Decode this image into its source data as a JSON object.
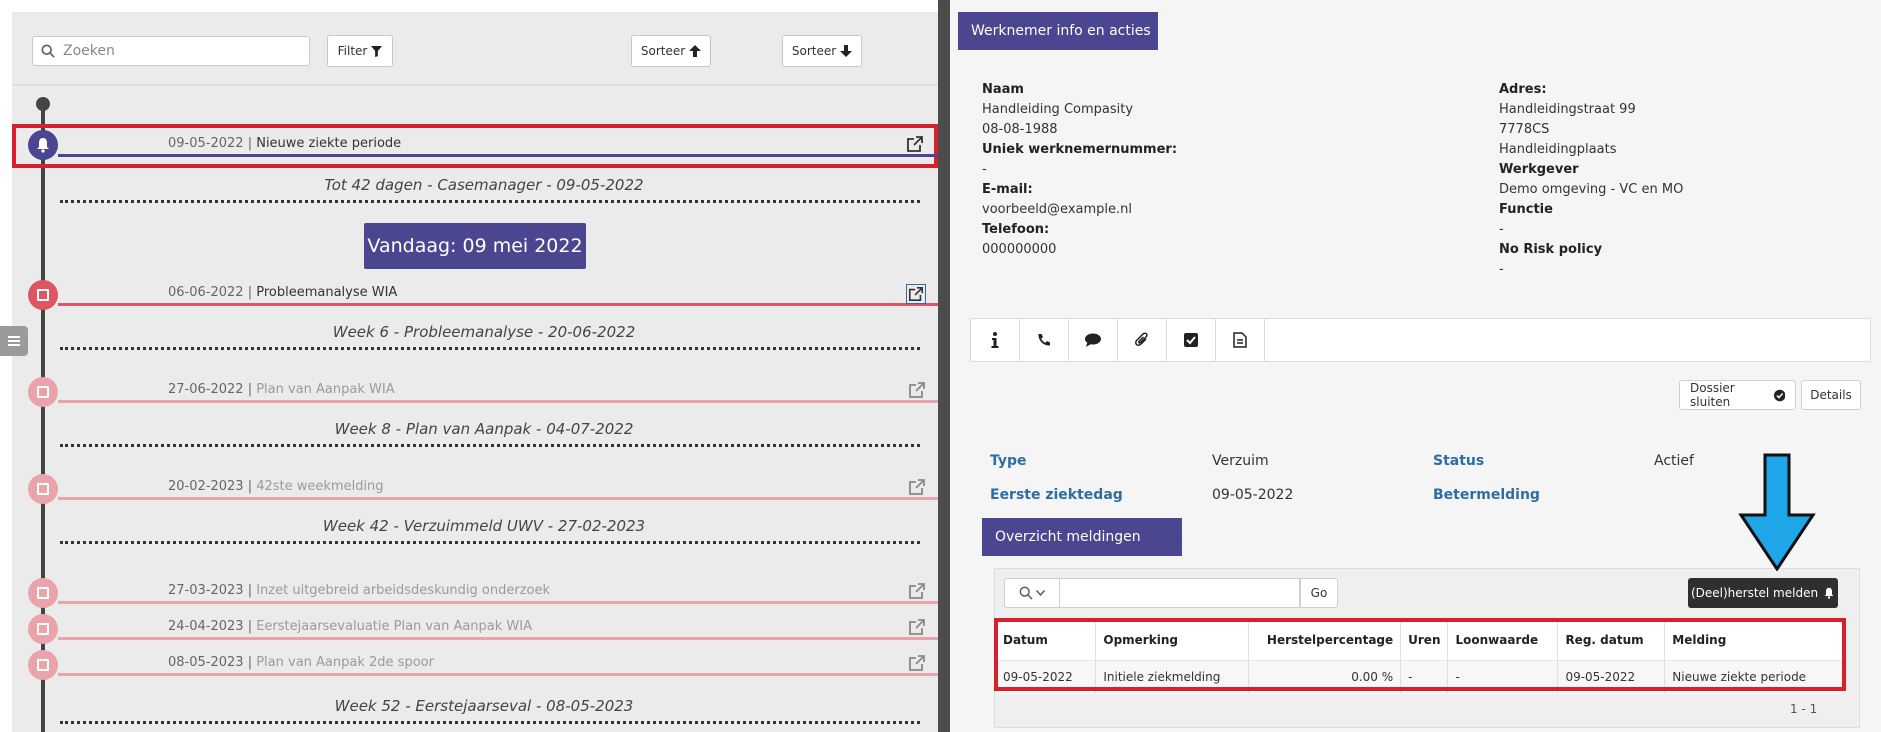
{
  "toolbar": {
    "search_placeholder": "Zoeken",
    "filter_label": "Filter",
    "sort_asc_label": "Sorteer",
    "sort_desc_label": "Sorteer"
  },
  "timeline": {
    "events": [
      {
        "date": "09-05-2022",
        "desc": "Nieuwe ziekte periode"
      },
      {
        "date": "06-06-2022",
        "desc": "Probleemanalyse WIA"
      },
      {
        "date": "27-06-2022",
        "desc": "Plan van Aanpak WIA"
      },
      {
        "date": "20-02-2023",
        "desc": "42ste weekmelding"
      },
      {
        "date": "27-03-2023",
        "desc": "Inzet uitgebreid arbeidsdeskundig onderzoek"
      },
      {
        "date": "24-04-2023",
        "desc": "Eerstejaarsevaluatie Plan van Aanpak WIA"
      },
      {
        "date": "08-05-2023",
        "desc": "Plan van Aanpak 2de spoor"
      }
    ],
    "milestones": [
      "Tot 42 dagen - Casemanager - 09-05-2022",
      "Week 6 - Probleemanalyse - 20-06-2022",
      "Week 8 - Plan van Aanpak - 04-07-2022",
      "Week 42 - Verzuimmeld UWV - 27-02-2023",
      "Week 52 - Eerstejaarseval - 08-05-2023"
    ],
    "separator": " | ",
    "today_label": "Vandaag: 09 mei 2022"
  },
  "panel": {
    "tab_label": "Werknemer info en acties",
    "left": {
      "naam_label": "Naam",
      "naam": "Handleiding Compasity",
      "geboortedatum": "08-08-1988",
      "werknemernummer_label": "Uniek werknemernummer:",
      "werknemernummer": "-",
      "email_label": "E-mail:",
      "email": "voorbeeld@example.nl",
      "telefoon_label": "Telefoon:",
      "telefoon": "000000000"
    },
    "right": {
      "adres_label": "Adres:",
      "straat": "Handleidingstraat 99",
      "postcode": "7778CS",
      "plaats": "Handleidingplaats",
      "werkgever_label": "Werkgever",
      "werkgever": "Demo omgeving - VC en MO",
      "functie_label": "Functie",
      "functie": "-",
      "norisk_label": "No Risk policy",
      "norisk": "-"
    }
  },
  "icon_tabs": [
    "info-icon",
    "phone-icon",
    "comment-icon",
    "paperclip-icon",
    "checkbox-icon",
    "document-icon"
  ],
  "actions": {
    "dossier_sluiten": "Dossier sluiten",
    "details": "Details"
  },
  "case": {
    "type_label": "Type",
    "type_value": "Verzuim",
    "status_label": "Status",
    "status_value": "Actief",
    "ziektedag_label": "Eerste ziektedag",
    "ziektedag_value": "09-05-2022",
    "betermelding_label": "Betermelding"
  },
  "overview": {
    "tab_label": "Overzicht meldingen",
    "go_label": "Go",
    "herstel_label": "(Deel)herstel melden",
    "columns": [
      "Datum",
      "Opmerking",
      "Herstelpercentage",
      "Uren",
      "Loonwaarde",
      "Reg. datum",
      "Melding"
    ],
    "rows": [
      [
        "09-05-2022",
        "Initiele ziekmelding",
        "0.00 %",
        "-",
        "-",
        "09-05-2022",
        "Nieuwe ziekte periode"
      ]
    ],
    "pager": "1 - 1"
  },
  "colors": {
    "accent": "#4a4790",
    "event_red": "#de5563",
    "highlight": "#d9202a",
    "arrow": "#1fa6e8"
  }
}
